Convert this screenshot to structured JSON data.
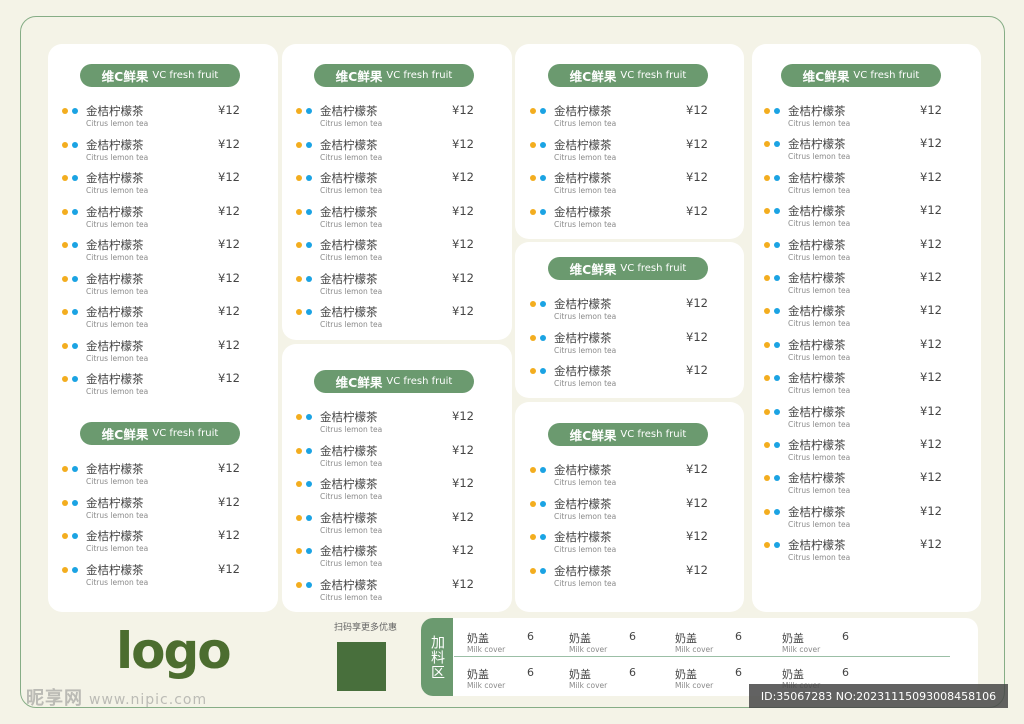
{
  "section_header": {
    "zh": "维C鲜果",
    "en": "VC fresh fruit"
  },
  "menu_item": {
    "name": "金桔柠檬茶",
    "en": "Citrus lemon tea",
    "price": "¥12"
  },
  "sections": [
    {
      "id": "s1",
      "items": 9
    },
    {
      "id": "s2",
      "items": 4
    },
    {
      "id": "s3",
      "items": 7
    },
    {
      "id": "s4",
      "items": 6
    },
    {
      "id": "s5",
      "items": 4
    },
    {
      "id": "s6",
      "items": 3
    },
    {
      "id": "s7",
      "items": 4
    },
    {
      "id": "s8",
      "items": 14
    }
  ],
  "brand": {
    "logo_text": "logo"
  },
  "qr": {
    "caption": "扫码享更多优惠"
  },
  "toppings": {
    "label": "加料区",
    "item": {
      "name": "奶盖",
      "en": "Milk cover",
      "price": "6"
    },
    "rows": 2,
    "per_row": 4
  },
  "watermark": {
    "site": "昵享网",
    "url": "www.nipic.com"
  },
  "image_id": "ID:35067283 NO:20231115093008458106",
  "colors": {
    "accent": "#6b9a6f",
    "dot_yellow": "#f3ad1f",
    "dot_blue": "#1ba3e3",
    "logo": "#4c6d2f"
  }
}
